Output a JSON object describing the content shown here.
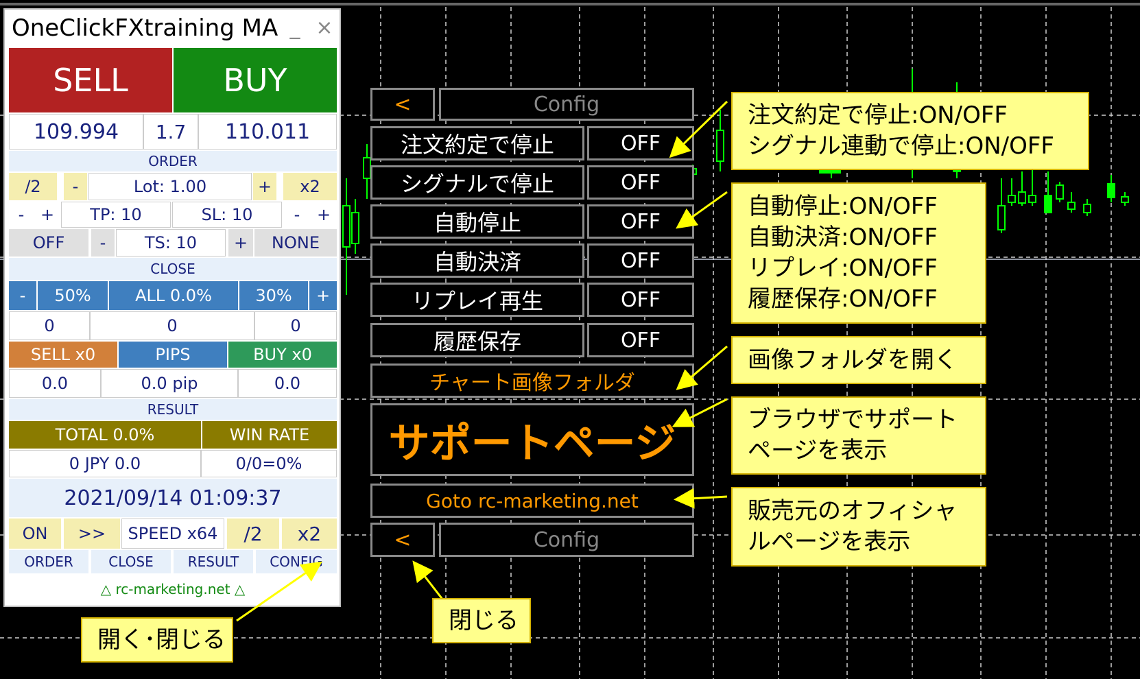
{
  "panel": {
    "title": "OneClickFXtraining MA",
    "minimize": "_",
    "close": "×",
    "sell": "SELL",
    "buy": "BUY",
    "bid": "109.994",
    "spread": "1.7",
    "ask": "110.011",
    "order_section": "ORDER",
    "half": "/2",
    "lot_minus": "-",
    "lot": "Lot: 1.00",
    "lot_plus": "+",
    "double": "x2",
    "tp_minus": "-",
    "tp_plus": "+",
    "tp": "TP: 10",
    "sl": "SL: 10",
    "sl_minus": "-",
    "sl_plus": "+",
    "ts_toggle": "OFF",
    "ts_minus": "-",
    "ts": "TS: 10",
    "ts_plus": "+",
    "ts_mode": "NONE",
    "close_section": "CLOSE",
    "close_minus": "-",
    "close_50": "50%",
    "close_all": "ALL 0.0%",
    "close_30": "30%",
    "close_plus": "+",
    "count_sell": "0",
    "count_mid": "0",
    "count_buy": "0",
    "sell_count": "SELL x0",
    "pips": "PIPS",
    "buy_count": "BUY x0",
    "sell_pips": "0.0",
    "total_pips": "0.0 pip",
    "buy_pips": "0.0",
    "result_section": "RESULT",
    "total": "TOTAL 0.0%",
    "win_rate": "WIN RATE",
    "jpy": "0 JPY 0.0",
    "ratio": "0/0=0%",
    "datetime": "2021/09/14  01:09:37",
    "on": "ON",
    "ff": ">>",
    "speed": "SPEED x64",
    "speed_half": "/2",
    "speed_double": "x2",
    "tab_order": "ORDER",
    "tab_close": "CLOSE",
    "tab_result": "RESULT",
    "tab_config": "CONFIG",
    "footer": "△ rc-marketing.net △"
  },
  "config": {
    "back": "<",
    "title": "Config",
    "rows": [
      {
        "label": "注文約定で停止",
        "value": "OFF"
      },
      {
        "label": "シグナルで停止",
        "value": "OFF"
      },
      {
        "label": "自動停止",
        "value": "OFF"
      },
      {
        "label": "自動決済",
        "value": "OFF"
      },
      {
        "label": "リプレイ再生",
        "value": "OFF"
      },
      {
        "label": "履歴保存",
        "value": "OFF"
      }
    ],
    "image_folder": "チャート画像フォルダ",
    "support": "サポートページ",
    "goto": "Goto rc-marketing.net",
    "back2": "<",
    "title2": "Config"
  },
  "callouts": {
    "c1_l1": "注文約定で停止:ON/OFF",
    "c1_l2": "シグナル連動で停止:ON/OFF",
    "c2_l1": "自動停止:ON/OFF",
    "c2_l2": "自動決済:ON/OFF",
    "c2_l3": "リプレイ:ON/OFF",
    "c2_l4": "履歴保存:ON/OFF",
    "c3": "画像フォルダを開く",
    "c4_l1": "ブラウザでサポート",
    "c4_l2": "ページを表示",
    "c5_l1": "販売元のオフィシャ",
    "c5_l2": "ルページを表示",
    "c6": "閉じる",
    "c7": "開く･閉じる"
  },
  "colors": {
    "sell": "#b22222",
    "buy": "#138a13",
    "candle": "#00ff00",
    "callout": "#ffff8c",
    "orange": "#ff9900"
  }
}
